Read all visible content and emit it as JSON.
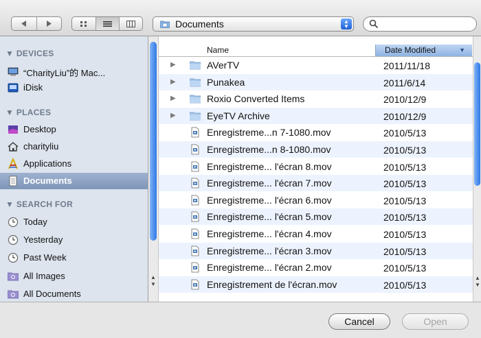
{
  "path": {
    "current": "Documents"
  },
  "search": {
    "value": "",
    "placeholder": ""
  },
  "sidebar": {
    "sections": [
      {
        "label": "DEVICES",
        "items": [
          {
            "label": "“CharityLiu”的 Mac...",
            "icon": "computer-icon"
          },
          {
            "label": "iDisk",
            "icon": "idisk-icon"
          }
        ]
      },
      {
        "label": "PLACES",
        "items": [
          {
            "label": "Desktop",
            "icon": "desktop-icon"
          },
          {
            "label": "charityliu",
            "icon": "home-icon"
          },
          {
            "label": "Applications",
            "icon": "applications-icon"
          },
          {
            "label": "Documents",
            "icon": "documents-icon",
            "selected": true
          }
        ]
      },
      {
        "label": "SEARCH FOR",
        "items": [
          {
            "label": "Today",
            "icon": "clock-icon"
          },
          {
            "label": "Yesterday",
            "icon": "clock-icon"
          },
          {
            "label": "Past Week",
            "icon": "clock-icon"
          },
          {
            "label": "All Images",
            "icon": "smart-folder-icon"
          },
          {
            "label": "All Documents",
            "icon": "smart-folder-icon"
          }
        ]
      }
    ]
  },
  "file_list": {
    "columns": {
      "name": "Name",
      "date": "Date Modified"
    },
    "rows": [
      {
        "name": "AVerTV",
        "date": "2011/11/18",
        "kind": "folder"
      },
      {
        "name": "Punakea",
        "date": "2011/6/14",
        "kind": "folder"
      },
      {
        "name": "Roxio Converted Items",
        "date": "2010/12/9",
        "kind": "folder"
      },
      {
        "name": "EyeTV Archive",
        "date": "2010/12/9",
        "kind": "folder"
      },
      {
        "name": "Enregistreme...n 7-1080.mov",
        "date": "2010/5/13",
        "kind": "file"
      },
      {
        "name": "Enregistreme...n 8-1080.mov",
        "date": "2010/5/13",
        "kind": "file"
      },
      {
        "name": "Enregistreme... l'écran 8.mov",
        "date": "2010/5/13",
        "kind": "file"
      },
      {
        "name": "Enregistreme... l'écran 7.mov",
        "date": "2010/5/13",
        "kind": "file"
      },
      {
        "name": "Enregistreme... l'écran 6.mov",
        "date": "2010/5/13",
        "kind": "file"
      },
      {
        "name": "Enregistreme... l'écran 5.mov",
        "date": "2010/5/13",
        "kind": "file"
      },
      {
        "name": "Enregistreme... l'écran 4.mov",
        "date": "2010/5/13",
        "kind": "file"
      },
      {
        "name": "Enregistreme... l'écran 3.mov",
        "date": "2010/5/13",
        "kind": "file"
      },
      {
        "name": "Enregistreme... l'écran 2.mov",
        "date": "2010/5/13",
        "kind": "file"
      },
      {
        "name": "Enregistrement de l'écran.mov",
        "date": "2010/5/13",
        "kind": "file"
      }
    ]
  },
  "buttons": {
    "cancel": "Cancel",
    "open": "Open"
  },
  "colors": {
    "accent": "#2f78e5",
    "selection": "#8aa0c2",
    "sidebar_bg": "#dde4ee"
  }
}
